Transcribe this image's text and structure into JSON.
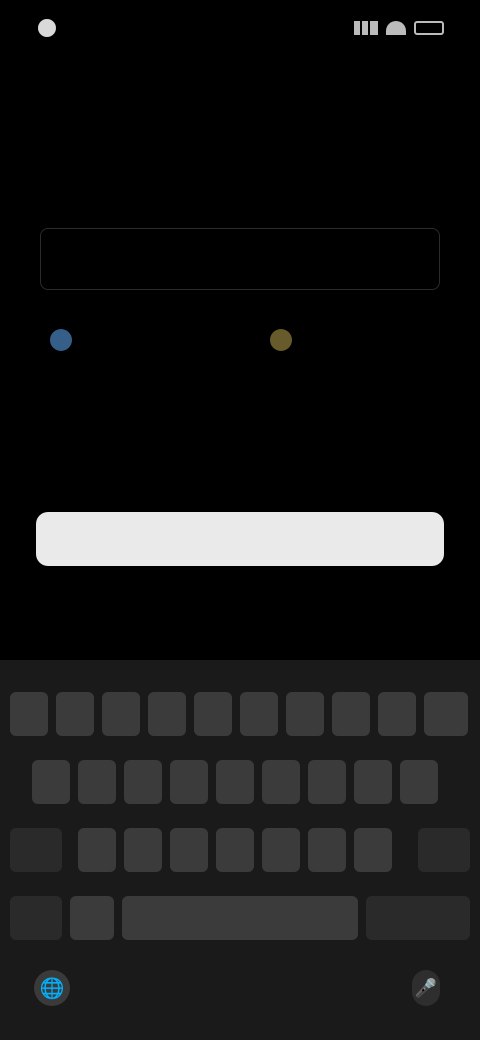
{
  "status_bar": {
    "time": "",
    "icons": [
      "signal-icon",
      "wifi-icon",
      "battery-icon"
    ]
  },
  "form": {
    "title": "",
    "subtitle": "",
    "input_value": "",
    "option_left_label": "",
    "option_right_label": ""
  },
  "primary_button": {
    "label": ""
  },
  "footnote": "",
  "keyboard": {
    "row1": [
      "",
      "",
      "",
      "",
      "",
      "",
      "",
      "",
      "",
      ""
    ],
    "row2": [
      "",
      "",
      "",
      "",
      "",
      "",
      "",
      "",
      ""
    ],
    "row3": [
      "",
      "",
      "",
      "",
      "",
      "",
      "",
      "",
      ""
    ],
    "row4": [
      "",
      "",
      "",
      ""
    ],
    "globe_icon": "globe-icon",
    "mic_icon": "mic-icon"
  },
  "colors": {
    "background": "#000000",
    "button": "#eaeaea",
    "keyboard": "#1a1a1a",
    "key": "#3b3b3b",
    "accent_blue": "#3e6fa0",
    "accent_gold": "#8a7a3a"
  }
}
